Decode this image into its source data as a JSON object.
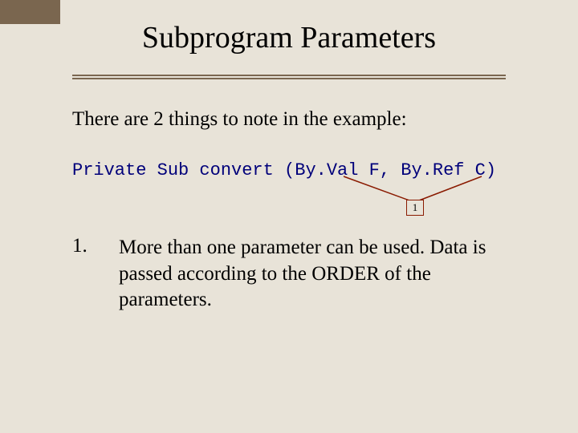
{
  "title": "Subprogram Parameters",
  "intro": "There are 2 things to note in the example:",
  "code": "Private Sub convert (By.Val F, By.Ref C)",
  "callout_label": "1",
  "list": {
    "num": "1.",
    "body": "More than one parameter can be used. Data is passed according to the ORDER of the parameters."
  }
}
